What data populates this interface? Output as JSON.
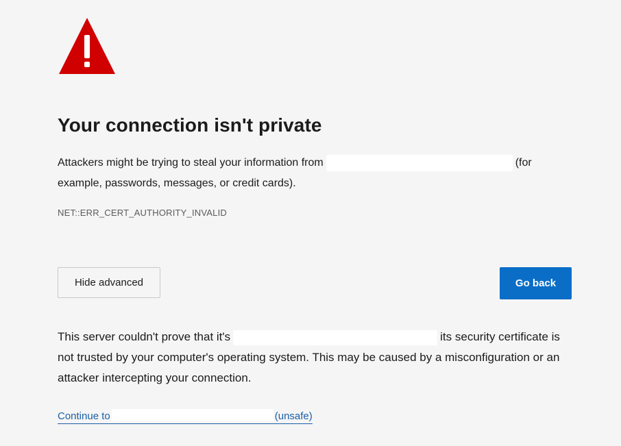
{
  "page": {
    "title": "Your connection isn't private",
    "description_before": "Attackers might be trying to steal your information from",
    "description_after": "(for example, passwords, messages, or credit cards).",
    "error_code": "NET::ERR_CERT_AUTHORITY_INVALID"
  },
  "buttons": {
    "hide_advanced_label": "Hide advanced",
    "go_back_label": "Go back"
  },
  "advanced": {
    "text_before": "This server couldn't prove that it's",
    "text_after": "its security certificate is not trusted by your computer's operating system. This may be caused by a misconfiguration or an attacker intercepting your connection.",
    "continue_before": "Continue to",
    "continue_after": "(unsafe)"
  },
  "colors": {
    "background": "#f5f5f5",
    "warning_red": "#d10000",
    "primary_button": "#0a6ec7",
    "link": "#1a5fa6"
  },
  "icons": {
    "warning": "warning-triangle-icon"
  }
}
